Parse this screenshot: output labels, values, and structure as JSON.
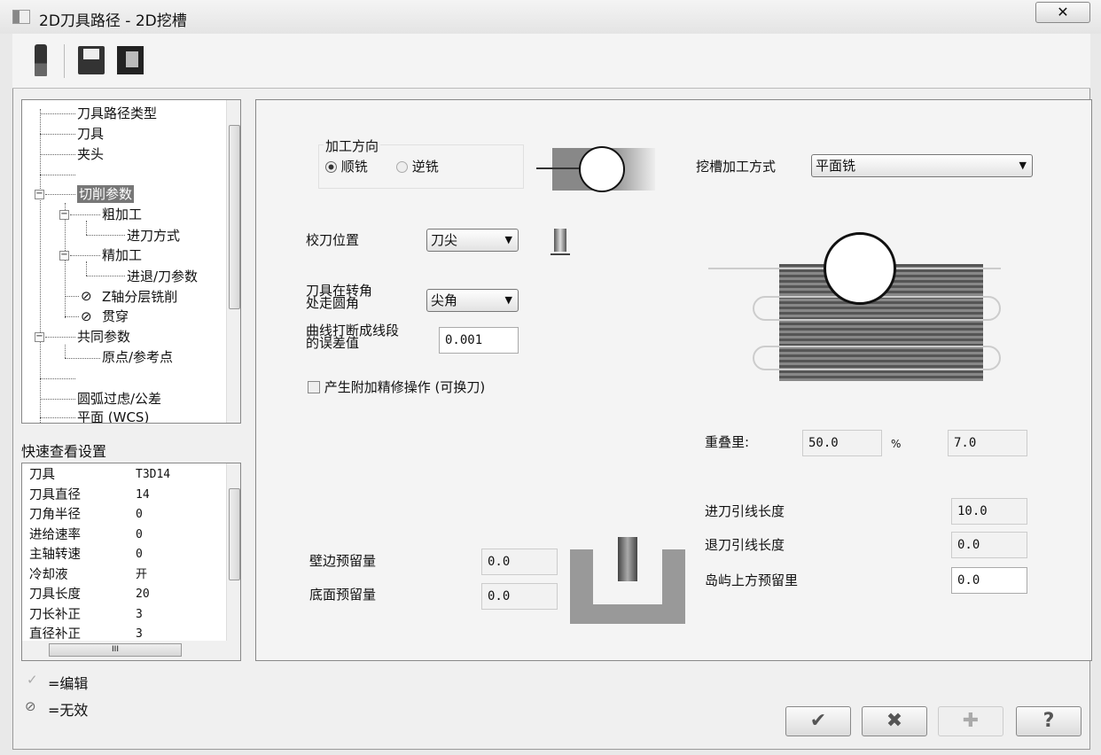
{
  "window": {
    "title": "2D刀具路径 - 2D挖槽",
    "close_glyph": "✕"
  },
  "toolbar": {
    "tool_icon": "tool-holder-icon",
    "save_icon": "save-icon",
    "save_as_icon": "save-as-icon"
  },
  "tree": {
    "items": [
      {
        "label": "刀具路径类型"
      },
      {
        "label": "刀具"
      },
      {
        "label": "夹头"
      },
      {
        "label": ""
      },
      {
        "label": "切削参数"
      },
      {
        "label": "粗加工"
      },
      {
        "label": "进刀方式"
      },
      {
        "label": "精加工"
      },
      {
        "label": "进退/刀参数"
      },
      {
        "label": "Z轴分层铣削"
      },
      {
        "label": "贯穿"
      },
      {
        "label": "共同参数"
      },
      {
        "label": "原点/参考点"
      },
      {
        "label": ""
      },
      {
        "label": "圆弧过虑/公差"
      },
      {
        "label": "平面 (WCS)"
      }
    ],
    "disabled_glyph": "⊘"
  },
  "quick_view": {
    "title": "快速查看设置",
    "rows": [
      {
        "k": "刀具",
        "v": "T3D14"
      },
      {
        "k": "刀具直径",
        "v": "14"
      },
      {
        "k": "刀角半径",
        "v": "0"
      },
      {
        "k": "进给速率",
        "v": "0"
      },
      {
        "k": "主轴转速",
        "v": "0"
      },
      {
        "k": "冷却液",
        "v": "开"
      },
      {
        "k": "刀具长度",
        "v": "20"
      },
      {
        "k": "刀长补正",
        "v": "3"
      },
      {
        "k": "直径补正",
        "v": "3"
      }
    ],
    "hscroll_grip": "III"
  },
  "legend": {
    "edit_glyph": "✓",
    "edit": "=编辑",
    "invalid_glyph": "⊘",
    "invalid": "=无效"
  },
  "main": {
    "direction": {
      "label": "加工方向",
      "climb": "顺铣",
      "conventional": "逆铣",
      "selected": "顺铣"
    },
    "pocket_method": {
      "label": "挖槽加工方式",
      "value": "平面铣"
    },
    "tip_position": {
      "label": "校刀位置",
      "value": "刀尖"
    },
    "corner": {
      "label1": "刀具在转角",
      "label2": "处走圆角",
      "value": "尖角"
    },
    "tolerance": {
      "label1": "曲线打断成线段",
      "label2": "的误差值",
      "value": "0.001"
    },
    "extra_finish": {
      "label": "产生附加精修操作 (可换刀)",
      "checked": false
    },
    "overlap": {
      "label": "重叠里:",
      "percent": "50.0",
      "unit": "%",
      "value": "7.0"
    },
    "entry_length": {
      "label": "进刀引线长度",
      "value": "10.0"
    },
    "exit_length": {
      "label": "退刀引线长度",
      "value": "0.0"
    },
    "island_stock": {
      "label": "岛屿上方预留里",
      "value": "0.0"
    },
    "wall_stock": {
      "label": "壁边预留量",
      "value": "0.0"
    },
    "floor_stock": {
      "label": "底面预留量",
      "value": "0.0"
    }
  },
  "buttons": {
    "ok": "✔",
    "cancel": "✖",
    "add": "✚",
    "help": "?"
  }
}
